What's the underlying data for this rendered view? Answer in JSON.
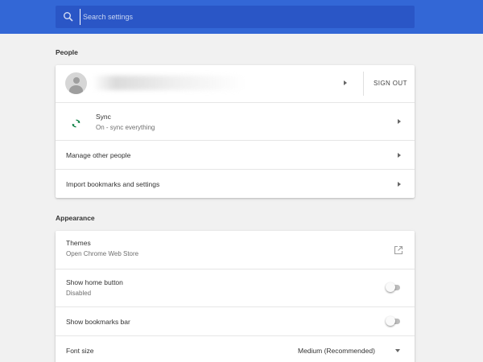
{
  "search": {
    "placeholder": "Search settings"
  },
  "people": {
    "title": "People",
    "sign_out_label": "SIGN OUT",
    "sync": {
      "label": "Sync",
      "status": "On - sync everything"
    },
    "manage_label": "Manage other people",
    "import_label": "Import bookmarks and settings"
  },
  "appearance": {
    "title": "Appearance",
    "themes": {
      "label": "Themes",
      "sublabel": "Open Chrome Web Store"
    },
    "home_button": {
      "label": "Show home button",
      "status": "Disabled"
    },
    "bookmarks_bar": {
      "label": "Show bookmarks bar"
    },
    "font_size": {
      "label": "Font size",
      "value": "Medium (Recommended)"
    }
  },
  "colors": {
    "header": "#3367d6",
    "search_bg": "#2a56c6",
    "sync_icon": "#0b8043"
  },
  "icons": {
    "search": "search-icon",
    "sync": "sync-icon",
    "external_link": "external-link-icon"
  }
}
